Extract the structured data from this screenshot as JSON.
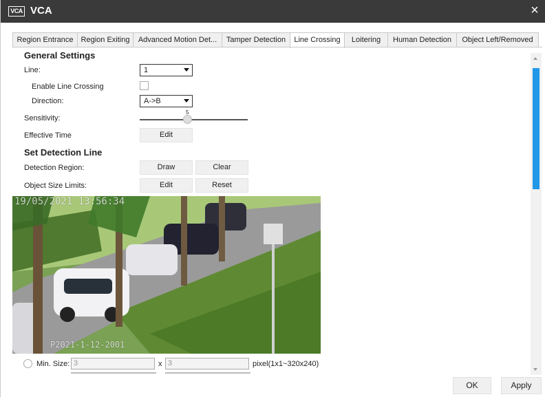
{
  "window": {
    "title": "VCA",
    "icon_text": "VCA",
    "close_glyph": "×"
  },
  "tabs": [
    {
      "label": "Region Entrance"
    },
    {
      "label": "Region Exiting"
    },
    {
      "label": "Advanced Motion Det..."
    },
    {
      "label": "Tamper Detection"
    },
    {
      "label": "Line Crossing",
      "active": true
    },
    {
      "label": "Loitering"
    },
    {
      "label": "Human Detection"
    },
    {
      "label": "Object Left/Removed"
    }
  ],
  "general": {
    "heading": "General Settings",
    "line_label": "Line:",
    "line_value": "1",
    "enable_label": "Enable Line Crossing",
    "enable_checked": false,
    "direction_label": "Direction:",
    "direction_value": "A->B",
    "sensitivity_label": "Sensitivity:",
    "sensitivity_value": "5",
    "effective_time_label": "Effective Time",
    "edit_label": "Edit"
  },
  "detection": {
    "heading": "Set Detection Line",
    "region_label": "Detection Region:",
    "draw_label": "Draw",
    "clear_label": "Clear",
    "size_label": "Object Size Limits:",
    "edit_label": "Edit",
    "reset_label": "Reset"
  },
  "video": {
    "timestamp": "19/05/2021 13:56:34",
    "camera_name": "P2021-1-12-2001"
  },
  "min_size": {
    "label": "Min. Size:",
    "width": "3",
    "sep": "x",
    "height": "3",
    "hint": "pixel(1x1~320x240)"
  },
  "footer": {
    "ok_label": "OK",
    "apply_label": "Apply"
  },
  "colors": {
    "titlebar": "#3a3a3a",
    "scroll_thumb": "#1f98e8"
  }
}
